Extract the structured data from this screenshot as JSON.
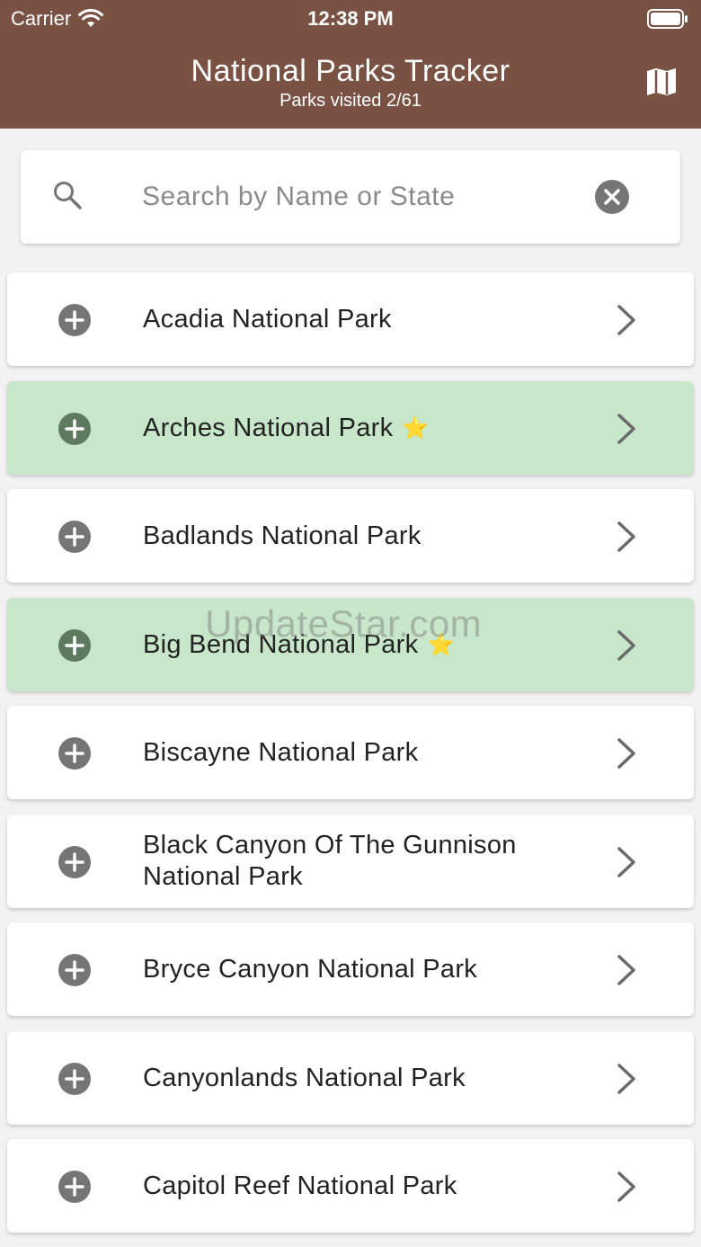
{
  "status_bar": {
    "carrier": "Carrier",
    "time": "12:38 PM"
  },
  "header": {
    "title": "National Parks Tracker",
    "subtitle": "Parks visited 2/61"
  },
  "search": {
    "placeholder": "Search by Name or State",
    "value": ""
  },
  "parks": [
    {
      "name": "Acadia National Park",
      "visited": false
    },
    {
      "name": "Arches National Park",
      "visited": true,
      "star": "⭐"
    },
    {
      "name": "Badlands National Park",
      "visited": false
    },
    {
      "name": "Big Bend National Park",
      "visited": true,
      "star": "⭐"
    },
    {
      "name": "Biscayne National Park",
      "visited": false
    },
    {
      "name": "Black Canyon Of The Gunnison National Park",
      "visited": false
    },
    {
      "name": "Bryce Canyon National Park",
      "visited": false
    },
    {
      "name": "Canyonlands National Park",
      "visited": false
    },
    {
      "name": "Capitol Reef National Park",
      "visited": false
    }
  ],
  "watermark": "UpdateStar.com",
  "colors": {
    "header": "#7a5244",
    "visited_row": "#c8e6c9",
    "icon_gray": "#757575",
    "icon_visited": "#5d7a5e"
  }
}
